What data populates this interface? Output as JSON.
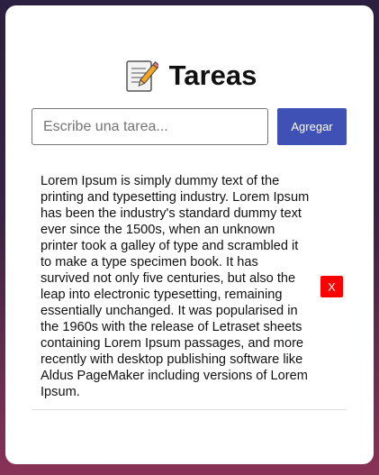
{
  "header": {
    "icon": "memo-icon",
    "title": "Tareas"
  },
  "form": {
    "placeholder": "Escribe una tarea...",
    "value": "",
    "add_label": "Agregar"
  },
  "tasks": [
    {
      "text": "Lorem Ipsum is simply dummy text of the printing and typesetting industry. Lorem Ipsum has been the industry's standard dummy text ever since the 1500s, when an unknown printer took a galley of type and scrambled it to make a type specimen book. It has survived not only five centuries, but also the leap into electronic typesetting, remaining essentially unchanged. It was popularised in the 1960s with the release of Letraset sheets containing Lorem Ipsum passages, and more recently with desktop publishing software like Aldus PageMaker including versions of Lorem Ipsum.",
      "delete_label": "X"
    }
  ],
  "colors": {
    "accent": "#3f51b5",
    "delete": "#ff0000"
  }
}
